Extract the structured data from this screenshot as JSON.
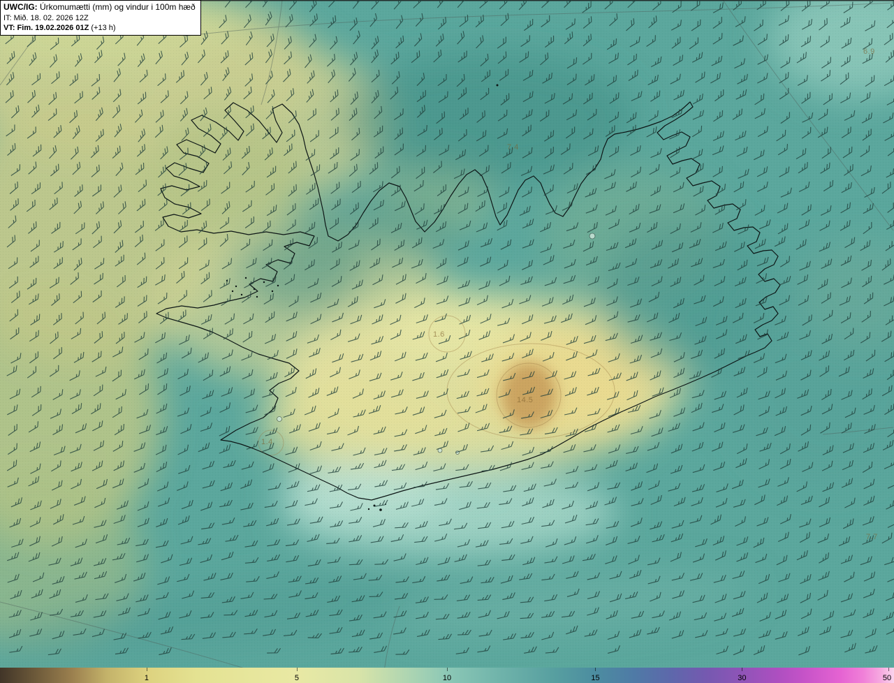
{
  "header": {
    "model_label": "UWC/IG:",
    "product_title": "Úrkomumætti (mm) og vindur i 100m hæð",
    "init_line": "IT: Mið. 18. 02. 2026 12Z",
    "valid_bold": "VT: Fim. 19.02.2026 01Z",
    "valid_suffix": "(+13 h)"
  },
  "map": {
    "annotations": [
      {
        "text": "6.9"
      },
      {
        "text": "7.4"
      },
      {
        "text": "1.6"
      },
      {
        "text": "14.5"
      },
      {
        "text": "7.7"
      },
      {
        "text": "1.4"
      }
    ]
  },
  "colorbar": {
    "labels": [
      "1",
      "5",
      "10",
      "15",
      "30",
      "50"
    ],
    "gradient_stops": [
      "#413528",
      "#9a7f4e",
      "#ddd27f",
      "#e9e9a4",
      "#8cc8b6",
      "#4c8da0",
      "#5d68ab",
      "#8f54b8",
      "#c653c8",
      "#f07fd8",
      "#fad3ec"
    ]
  },
  "wind": {
    "barb_color": "#21403c"
  }
}
